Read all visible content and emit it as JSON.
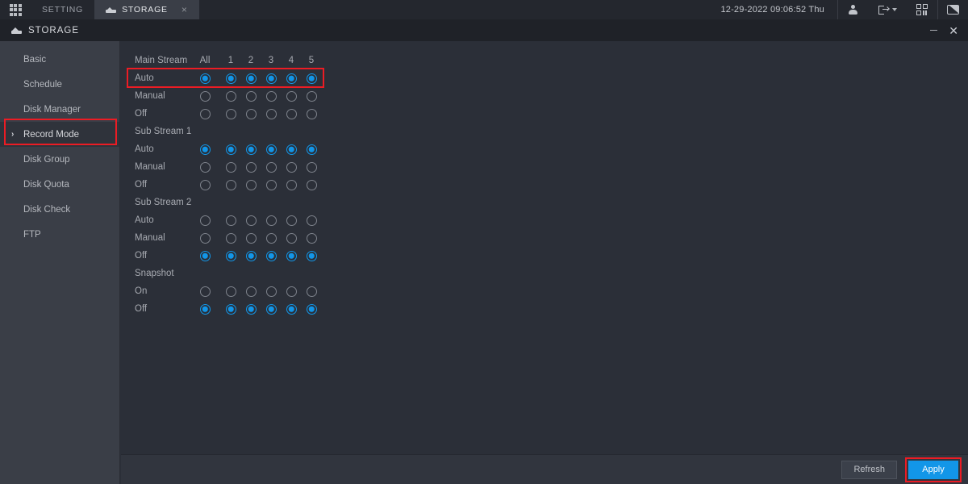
{
  "topbar": {
    "grid_icon": "grid-menu-icon",
    "tabs": [
      {
        "label": "SETTING",
        "icon": "",
        "active": false,
        "closable": false
      },
      {
        "label": "STORAGE",
        "icon": "hdd-icon",
        "active": true,
        "closable": true,
        "close_glyph": "×"
      }
    ],
    "datetime": "12-29-2022 09:06:52 Thu",
    "icons": [
      {
        "name": "user-icon"
      },
      {
        "name": "logout-icon"
      },
      {
        "name": "qr-code-icon"
      },
      {
        "name": "display-monitor-icon"
      }
    ]
  },
  "window": {
    "title": "STORAGE",
    "icon": "hdd-icon",
    "minimize_glyph": "",
    "close_glyph": "✕"
  },
  "sidebar": {
    "items": [
      {
        "label": "Basic",
        "active": false
      },
      {
        "label": "Schedule",
        "active": false
      },
      {
        "label": "Disk Manager",
        "active": false
      },
      {
        "label": "Record Mode",
        "active": true,
        "chevron": "›"
      },
      {
        "label": "Disk Group",
        "active": false
      },
      {
        "label": "Disk Quota",
        "active": false
      },
      {
        "label": "Disk Check",
        "active": false
      },
      {
        "label": "FTP",
        "active": false
      }
    ]
  },
  "record_mode": {
    "columns": [
      "All",
      "1",
      "2",
      "3",
      "4",
      "5"
    ],
    "sections": [
      {
        "title": "Main Stream",
        "rows": [
          {
            "label": "Auto",
            "selected": true,
            "highlighted": true
          },
          {
            "label": "Manual",
            "selected": false,
            "highlighted": false
          },
          {
            "label": "Off",
            "selected": false,
            "highlighted": false
          }
        ]
      },
      {
        "title": "Sub Stream 1",
        "rows": [
          {
            "label": "Auto",
            "selected": true,
            "highlighted": false
          },
          {
            "label": "Manual",
            "selected": false,
            "highlighted": false
          },
          {
            "label": "Off",
            "selected": false,
            "highlighted": false
          }
        ]
      },
      {
        "title": "Sub Stream 2",
        "rows": [
          {
            "label": "Auto",
            "selected": false,
            "highlighted": false
          },
          {
            "label": "Manual",
            "selected": false,
            "highlighted": false
          },
          {
            "label": "Off",
            "selected": true,
            "highlighted": false
          }
        ]
      },
      {
        "title": "Snapshot",
        "rows": [
          {
            "label": "On",
            "selected": false,
            "highlighted": false
          },
          {
            "label": "Off",
            "selected": true,
            "highlighted": false
          }
        ]
      }
    ]
  },
  "footer": {
    "refresh_label": "Refresh",
    "apply_label": "Apply",
    "apply_highlighted": true
  },
  "colors": {
    "accent_blue": "#1296e8",
    "highlight_red": "#ec1c24",
    "bg_content": "#2b2f38",
    "bg_sidebar": "#3a3e47",
    "bg_topbar": "#24272e"
  }
}
